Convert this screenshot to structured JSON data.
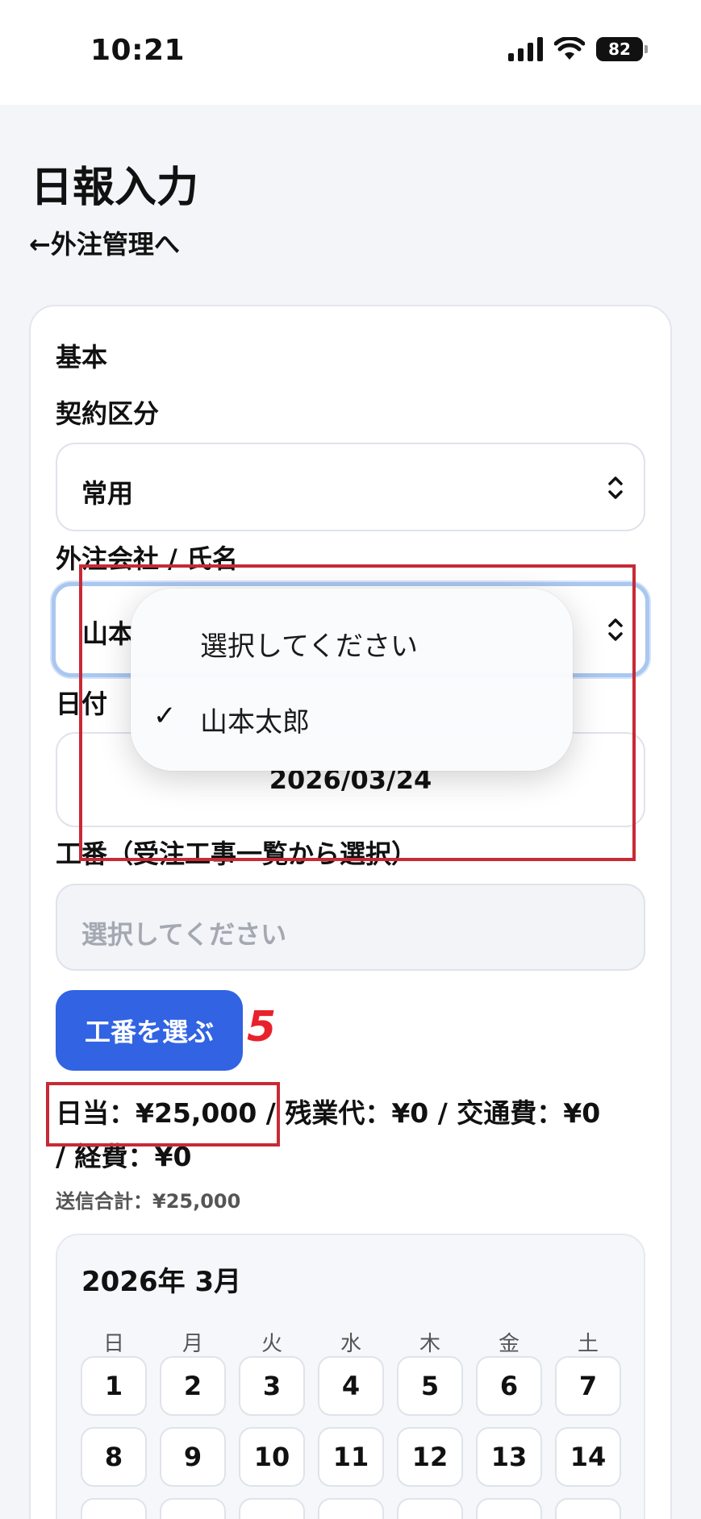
{
  "status": {
    "time": "10:21",
    "battery": "82"
  },
  "header": {
    "title": "日報入力",
    "back_link": "←外注管理へ"
  },
  "form": {
    "section": "基本",
    "contract_label": "契約区分",
    "contract_value": "常用",
    "vendor_label": "外注会社 / 氏名",
    "vendor_value": "山本",
    "date_label": "日付",
    "date_value": "2026/03/24",
    "job_label": "工番（受注工事一覧から選択）",
    "job_placeholder": "選択してください",
    "pick_button": "工番を選ぶ",
    "annotation_number": "5"
  },
  "summary": {
    "line1": "日当：¥25,000 / 残業代：¥0 / 交通費：¥0",
    "line2": "/ 経費：¥0",
    "total": "送信合計：¥25,000"
  },
  "dropdown": {
    "options": [
      {
        "label": "選択してください",
        "selected": false
      },
      {
        "label": "山本太郎",
        "selected": true
      }
    ],
    "check_mark": "✓"
  },
  "calendar": {
    "title": "2026年 3月",
    "weekdays": [
      "日",
      "月",
      "火",
      "水",
      "木",
      "金",
      "土"
    ],
    "week1": [
      "1",
      "2",
      "3",
      "4",
      "5",
      "6",
      "7"
    ],
    "week2": [
      "8",
      "9",
      "10",
      "11",
      "12",
      "13",
      "14"
    ]
  },
  "colors": {
    "accent": "#3163e3",
    "annotation": "#c72a36",
    "focus": "#a9c7f0"
  }
}
